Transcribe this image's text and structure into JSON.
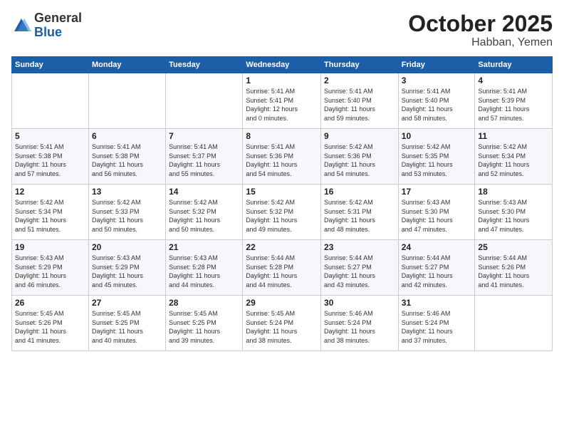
{
  "header": {
    "logo_general": "General",
    "logo_blue": "Blue",
    "month": "October 2025",
    "location": "Habban, Yemen"
  },
  "weekdays": [
    "Sunday",
    "Monday",
    "Tuesday",
    "Wednesday",
    "Thursday",
    "Friday",
    "Saturday"
  ],
  "weeks": [
    [
      {
        "day": "",
        "info": ""
      },
      {
        "day": "",
        "info": ""
      },
      {
        "day": "",
        "info": ""
      },
      {
        "day": "1",
        "info": "Sunrise: 5:41 AM\nSunset: 5:41 PM\nDaylight: 12 hours\nand 0 minutes."
      },
      {
        "day": "2",
        "info": "Sunrise: 5:41 AM\nSunset: 5:40 PM\nDaylight: 11 hours\nand 59 minutes."
      },
      {
        "day": "3",
        "info": "Sunrise: 5:41 AM\nSunset: 5:40 PM\nDaylight: 11 hours\nand 58 minutes."
      },
      {
        "day": "4",
        "info": "Sunrise: 5:41 AM\nSunset: 5:39 PM\nDaylight: 11 hours\nand 57 minutes."
      }
    ],
    [
      {
        "day": "5",
        "info": "Sunrise: 5:41 AM\nSunset: 5:38 PM\nDaylight: 11 hours\nand 57 minutes."
      },
      {
        "day": "6",
        "info": "Sunrise: 5:41 AM\nSunset: 5:38 PM\nDaylight: 11 hours\nand 56 minutes."
      },
      {
        "day": "7",
        "info": "Sunrise: 5:41 AM\nSunset: 5:37 PM\nDaylight: 11 hours\nand 55 minutes."
      },
      {
        "day": "8",
        "info": "Sunrise: 5:41 AM\nSunset: 5:36 PM\nDaylight: 11 hours\nand 54 minutes."
      },
      {
        "day": "9",
        "info": "Sunrise: 5:42 AM\nSunset: 5:36 PM\nDaylight: 11 hours\nand 54 minutes."
      },
      {
        "day": "10",
        "info": "Sunrise: 5:42 AM\nSunset: 5:35 PM\nDaylight: 11 hours\nand 53 minutes."
      },
      {
        "day": "11",
        "info": "Sunrise: 5:42 AM\nSunset: 5:34 PM\nDaylight: 11 hours\nand 52 minutes."
      }
    ],
    [
      {
        "day": "12",
        "info": "Sunrise: 5:42 AM\nSunset: 5:34 PM\nDaylight: 11 hours\nand 51 minutes."
      },
      {
        "day": "13",
        "info": "Sunrise: 5:42 AM\nSunset: 5:33 PM\nDaylight: 11 hours\nand 50 minutes."
      },
      {
        "day": "14",
        "info": "Sunrise: 5:42 AM\nSunset: 5:32 PM\nDaylight: 11 hours\nand 50 minutes."
      },
      {
        "day": "15",
        "info": "Sunrise: 5:42 AM\nSunset: 5:32 PM\nDaylight: 11 hours\nand 49 minutes."
      },
      {
        "day": "16",
        "info": "Sunrise: 5:42 AM\nSunset: 5:31 PM\nDaylight: 11 hours\nand 48 minutes."
      },
      {
        "day": "17",
        "info": "Sunrise: 5:43 AM\nSunset: 5:30 PM\nDaylight: 11 hours\nand 47 minutes."
      },
      {
        "day": "18",
        "info": "Sunrise: 5:43 AM\nSunset: 5:30 PM\nDaylight: 11 hours\nand 47 minutes."
      }
    ],
    [
      {
        "day": "19",
        "info": "Sunrise: 5:43 AM\nSunset: 5:29 PM\nDaylight: 11 hours\nand 46 minutes."
      },
      {
        "day": "20",
        "info": "Sunrise: 5:43 AM\nSunset: 5:29 PM\nDaylight: 11 hours\nand 45 minutes."
      },
      {
        "day": "21",
        "info": "Sunrise: 5:43 AM\nSunset: 5:28 PM\nDaylight: 11 hours\nand 44 minutes."
      },
      {
        "day": "22",
        "info": "Sunrise: 5:44 AM\nSunset: 5:28 PM\nDaylight: 11 hours\nand 44 minutes."
      },
      {
        "day": "23",
        "info": "Sunrise: 5:44 AM\nSunset: 5:27 PM\nDaylight: 11 hours\nand 43 minutes."
      },
      {
        "day": "24",
        "info": "Sunrise: 5:44 AM\nSunset: 5:27 PM\nDaylight: 11 hours\nand 42 minutes."
      },
      {
        "day": "25",
        "info": "Sunrise: 5:44 AM\nSunset: 5:26 PM\nDaylight: 11 hours\nand 41 minutes."
      }
    ],
    [
      {
        "day": "26",
        "info": "Sunrise: 5:45 AM\nSunset: 5:26 PM\nDaylight: 11 hours\nand 41 minutes."
      },
      {
        "day": "27",
        "info": "Sunrise: 5:45 AM\nSunset: 5:25 PM\nDaylight: 11 hours\nand 40 minutes."
      },
      {
        "day": "28",
        "info": "Sunrise: 5:45 AM\nSunset: 5:25 PM\nDaylight: 11 hours\nand 39 minutes."
      },
      {
        "day": "29",
        "info": "Sunrise: 5:45 AM\nSunset: 5:24 PM\nDaylight: 11 hours\nand 38 minutes."
      },
      {
        "day": "30",
        "info": "Sunrise: 5:46 AM\nSunset: 5:24 PM\nDaylight: 11 hours\nand 38 minutes."
      },
      {
        "day": "31",
        "info": "Sunrise: 5:46 AM\nSunset: 5:24 PM\nDaylight: 11 hours\nand 37 minutes."
      },
      {
        "day": "",
        "info": ""
      }
    ]
  ]
}
